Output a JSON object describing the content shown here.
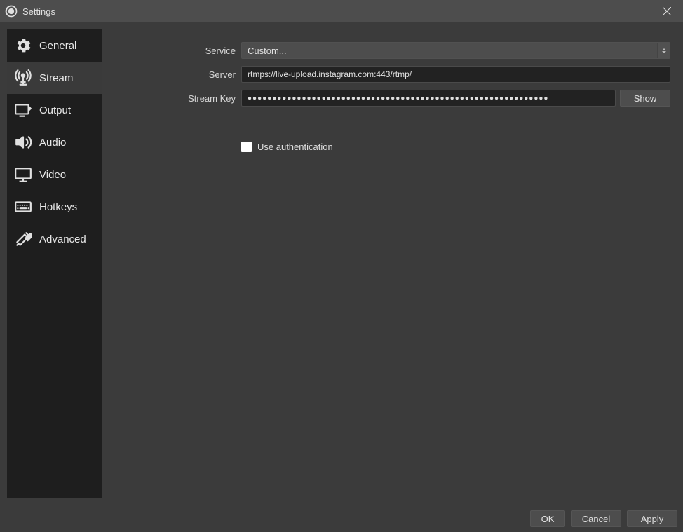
{
  "window": {
    "title": "Settings"
  },
  "sidebar": {
    "items": [
      {
        "label": "General",
        "name": "sidebar-item-general",
        "icon": "gear-icon",
        "active": false
      },
      {
        "label": "Stream",
        "name": "sidebar-item-stream",
        "icon": "broadcast-icon",
        "active": true
      },
      {
        "label": "Output",
        "name": "sidebar-item-output",
        "icon": "output-icon",
        "active": false
      },
      {
        "label": "Audio",
        "name": "sidebar-item-audio",
        "icon": "speaker-icon",
        "active": false
      },
      {
        "label": "Video",
        "name": "sidebar-item-video",
        "icon": "monitor-icon",
        "active": false
      },
      {
        "label": "Hotkeys",
        "name": "sidebar-item-hotkeys",
        "icon": "keyboard-icon",
        "active": false
      },
      {
        "label": "Advanced",
        "name": "sidebar-item-advanced",
        "icon": "tools-icon",
        "active": false
      }
    ]
  },
  "form": {
    "service_label": "Service",
    "service_value": "Custom...",
    "server_label": "Server",
    "server_value": "rtmps://live-upload.instagram.com:443/rtmp/",
    "streamkey_label": "Stream Key",
    "streamkey_masked_value": "●●●●●●●●●●●●●●●●●●●●●●●●●●●●●●●●●●●●●●●●●●●●●●●●●●●●●●●●●●●●●",
    "show_button_label": "Show",
    "auth_checkbox_label": "Use authentication",
    "auth_checkbox_checked": false
  },
  "footer": {
    "ok_label": "OK",
    "cancel_label": "Cancel",
    "apply_label": "Apply"
  }
}
